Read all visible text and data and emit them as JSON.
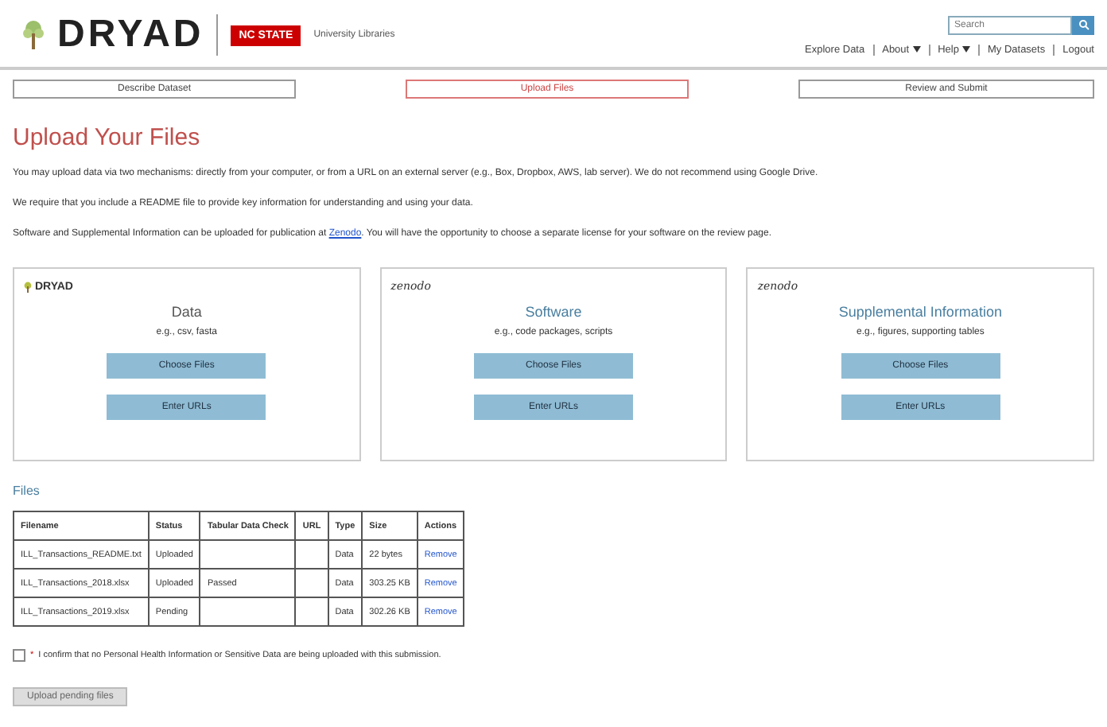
{
  "header": {
    "logo": "DRYAD",
    "partner_badge": "NC STATE",
    "partner_name": "University Libraries",
    "search": {
      "placeholder": "Search"
    },
    "nav": [
      {
        "label": "Explore Data",
        "dropdown": false
      },
      {
        "label": "About",
        "dropdown": true
      },
      {
        "label": "Help",
        "dropdown": true
      },
      {
        "label": "My Datasets",
        "dropdown": false
      },
      {
        "label": "Logout",
        "dropdown": false
      }
    ]
  },
  "steps": [
    {
      "label": "Describe Dataset",
      "selected": false
    },
    {
      "label": "Upload Files",
      "selected": true
    },
    {
      "label": "Review and Submit",
      "selected": false
    }
  ],
  "title": "Upload Your Files",
  "paragraphs": [
    {
      "text": "You may upload data via two mechanisms: directly from your computer, or from a URL on an external server (e.g., Box, Dropbox, AWS, lab server). We do not recommend using Google Drive."
    },
    {
      "text": "We require that you include a README file to provide key information for understanding and using your data."
    },
    {
      "text": "Software and Supplemental Information can be uploaded for publication at",
      "link": "Zenodo",
      "after": ". You will have the opportunity to choose a separate license for your software on the review page."
    }
  ],
  "cards": [
    {
      "kind": "dryad",
      "logo": "DRYAD",
      "title": "Data",
      "hint": "e.g., csv, fasta",
      "buttons": [
        "Choose Files",
        "Enter URLs"
      ]
    },
    {
      "kind": "zenodo",
      "logo": "zenodo",
      "title": "Software",
      "hint": "e.g., code packages, scripts",
      "buttons": [
        "Choose Files",
        "Enter URLs"
      ]
    },
    {
      "kind": "zenodo",
      "logo": "zenodo",
      "title": "Supplemental Information",
      "hint": "e.g., figures, supporting tables",
      "buttons": [
        "Choose Files",
        "Enter URLs"
      ]
    }
  ],
  "files": {
    "heading": "Files",
    "columns": [
      "Filename",
      "Status",
      "Tabular Data Check",
      "URL",
      "Type",
      "Size",
      "Actions"
    ],
    "rows": [
      [
        "ILL_Transactions_README.txt",
        "Uploaded",
        "",
        "",
        "Data",
        "22 bytes",
        "Remove"
      ],
      [
        "ILL_Transactions_2018.xlsx",
        "Uploaded",
        "Passed",
        "",
        "Data",
        "303.25 KB",
        "Remove"
      ],
      [
        "ILL_Transactions_2019.xlsx",
        "Pending",
        "",
        "",
        "Data",
        "302.26 KB",
        "Remove"
      ]
    ]
  },
  "confirm": {
    "checked": false,
    "required_mark": "*",
    "text": "I confirm that no Personal Health Information or Sensitive Data are being uploaded with this submission."
  },
  "upload_button": {
    "label": "Upload pending files",
    "disabled": true
  }
}
